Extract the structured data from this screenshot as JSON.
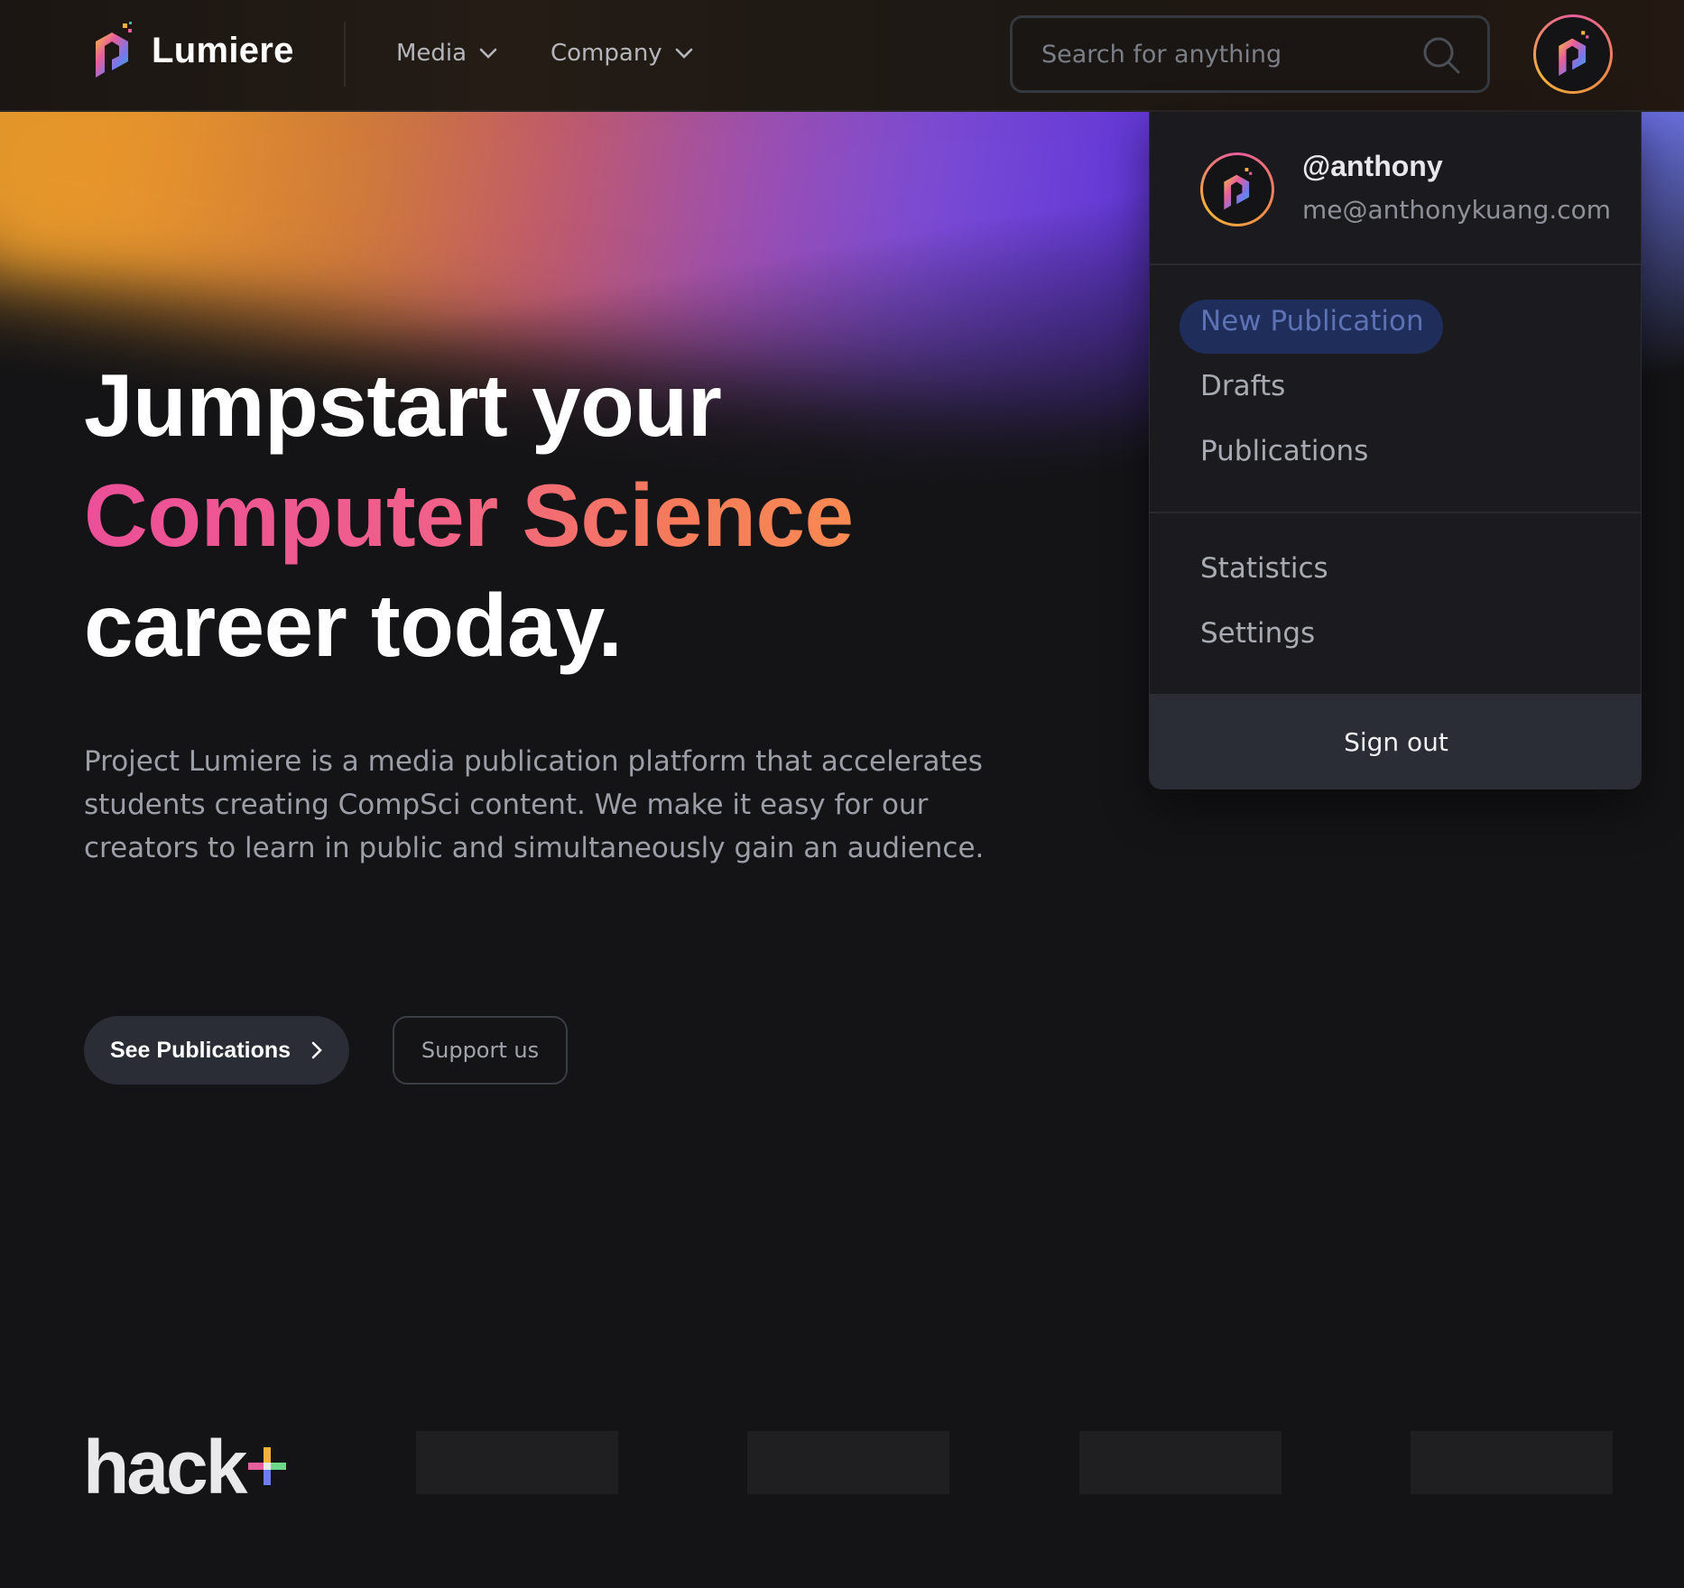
{
  "header": {
    "brand": "Lumiere",
    "nav": [
      {
        "label": "Media"
      },
      {
        "label": "Company"
      }
    ],
    "search_placeholder": "Search for anything"
  },
  "hero": {
    "title_line1": "Jumpstart your",
    "title_highlight": "Computer Science",
    "title_line3": "career today.",
    "description": "Project Lumiere is a media publication platform that accelerates students creating CompSci content. We make it easy for our creators to learn in public and simultaneously gain an audience.",
    "primary_button": "See Publications",
    "secondary_button": "Support us"
  },
  "partners": {
    "logo_text": "hack"
  },
  "user_menu": {
    "username": "@anthony",
    "email": "me@anthonykuang.com",
    "items": [
      {
        "label": "New Publication",
        "active": true
      },
      {
        "label": "Drafts"
      },
      {
        "label": "Publications"
      },
      {
        "label": "Statistics"
      },
      {
        "label": "Settings"
      }
    ],
    "signout": "Sign out"
  },
  "colors": {
    "background": "#141416",
    "accent_pink": "#ec4f98",
    "accent_orange": "#f88a52",
    "highlight": "#1e2d5a"
  }
}
